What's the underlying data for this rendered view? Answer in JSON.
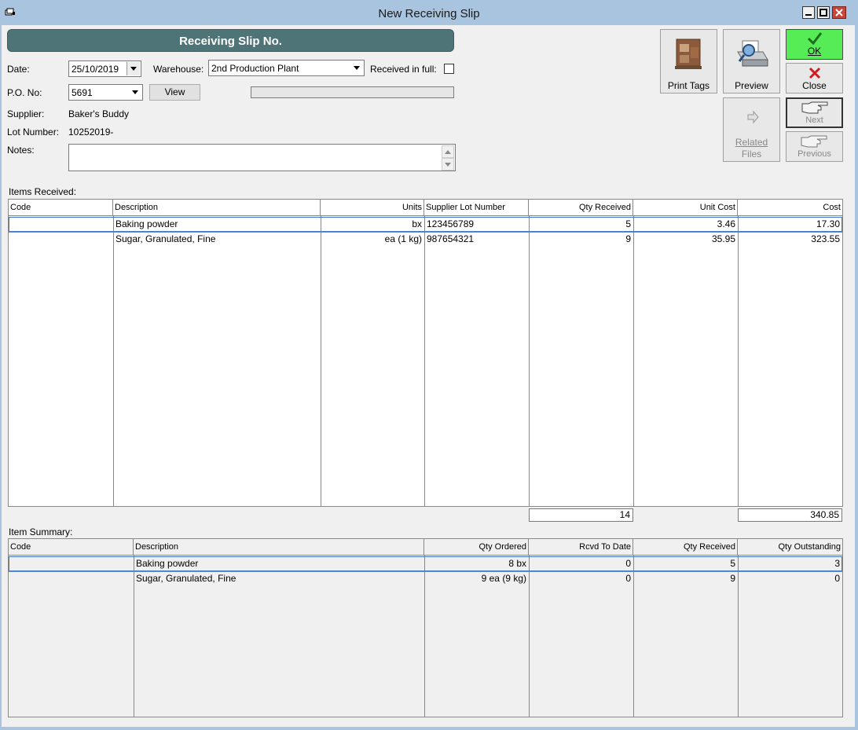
{
  "window": {
    "title": "New Receiving Slip"
  },
  "header": {
    "title": "Receiving Slip No."
  },
  "form": {
    "date_label": "Date:",
    "date_value": "25/10/2019",
    "warehouse_label": "Warehouse:",
    "warehouse_value": "2nd Production Plant",
    "received_in_full_label": "Received in full:",
    "received_in_full_checked": false,
    "po_label": "P.O. No:",
    "po_value": "5691",
    "view_button": "View",
    "supplier_label": "Supplier:",
    "supplier_value": "Baker's Buddy",
    "lot_label": "Lot Number:",
    "lot_value": "10252019-",
    "notes_label": "Notes:",
    "notes_value": ""
  },
  "actions": {
    "print_tags": "Print Tags",
    "preview": "Preview",
    "ok": "OK",
    "close": "Close",
    "next": "Next",
    "related_files_1": "Related",
    "related_files_2": "Files",
    "previous": "Previous"
  },
  "items_received": {
    "label": "Items Received:",
    "columns": [
      "Code",
      "Description",
      "Units",
      "Supplier Lot Number",
      "Qty Received",
      "Unit Cost",
      "Cost"
    ],
    "rows": [
      {
        "code": "",
        "description": "Baking powder",
        "units": "bx",
        "supplier_lot": "123456789",
        "qty_received": "5",
        "unit_cost": "3.46",
        "cost": "17.30"
      },
      {
        "code": "",
        "description": "Sugar, Granulated, Fine",
        "units": "ea (1 kg)",
        "supplier_lot": "987654321",
        "qty_received": "9",
        "unit_cost": "35.95",
        "cost": "323.55"
      }
    ],
    "total_qty": "14",
    "total_cost": "340.85"
  },
  "item_summary": {
    "label": "Item Summary:",
    "columns": [
      "Code",
      "Description",
      "Qty Ordered",
      "Rcvd To Date",
      "Qty Received",
      "Qty Outstanding"
    ],
    "rows": [
      {
        "code": "",
        "description": "Baking powder",
        "qty_ordered": "8 bx",
        "rcvd_to_date": "0",
        "qty_received": "5",
        "qty_outstanding": "3"
      },
      {
        "code": "",
        "description": "Sugar, Granulated, Fine",
        "qty_ordered": "9 ea (9 kg)",
        "rcvd_to_date": "0",
        "qty_received": "9",
        "qty_outstanding": "0"
      }
    ]
  },
  "colors": {
    "header_bar": "#4f7478",
    "ok_button": "#55ec55",
    "window_frame": "#a9c4de",
    "selection": "#3d7cc9"
  },
  "icons": [
    "app-icon",
    "minimize-icon",
    "maximize-icon",
    "close-window-icon",
    "boxes-icon",
    "printer-icon",
    "checkmark-icon",
    "x-icon",
    "pointing-hand-icon",
    "related-files-icon"
  ]
}
